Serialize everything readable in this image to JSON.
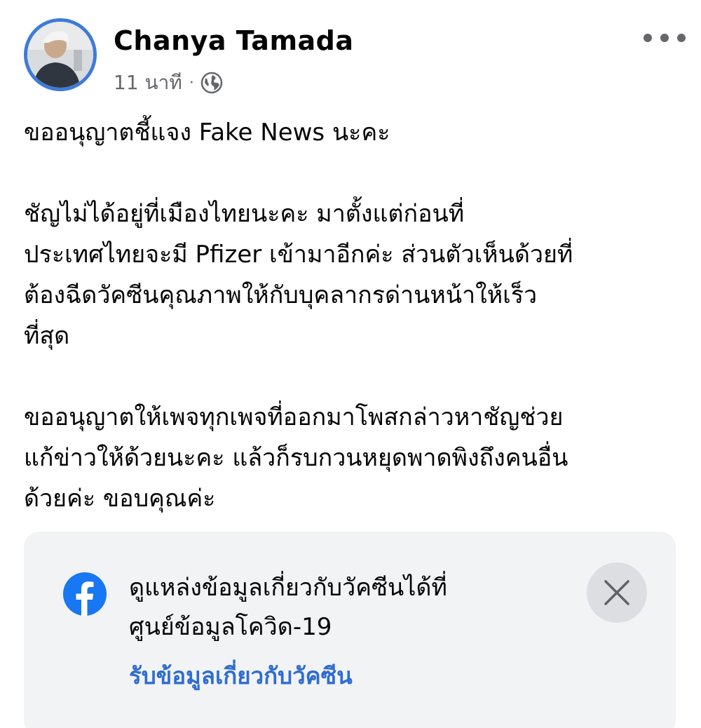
{
  "post": {
    "author": "Chanya Tamada",
    "timestamp": "11 นาที",
    "separator": "·",
    "privacy_icon": "globe-icon",
    "more_icon": "more-options-icon",
    "paragraphs": [
      [
        "ขออนุญาตชี้แจง Fake News นะคะ"
      ],
      [
        "ชัญไม่ได้อยู่ที่เมืองไทยนะคะ มาตั้งแต่ก่อนที่",
        "ประเทศไทยจะมี Pfizer เข้ามาอีกค่ะ ส่วนตัวเห็นด้วยที่",
        "ต้องฉีดวัคซีนคุณภาพให้กับบุคลากรด่านหน้าให้เร็ว",
        "ที่สุด"
      ],
      [
        "ขออนุญาตให้เพจทุกเพจที่ออกมาโพสกล่าวหาชัญช่วย",
        "แก้ข่าวให้ด้วยนะคะ แล้วก็รบกวนหยุดพาดพิงถึงคนอื่น",
        "ด้วยค่ะ ขอบคุณค่ะ"
      ]
    ]
  },
  "info_card": {
    "logo_icon": "facebook-logo-icon",
    "message_lines": [
      "ดูแหล่งข้อมูลเกี่ยวกับวัคซีนได้ที่",
      "ศูนย์ข้อมูลโควิด-19"
    ],
    "link_label": "รับข้อมูลเกี่ยวกับวัคซีน",
    "close_icon": "close-icon"
  },
  "colors": {
    "link": "#2e6cd1",
    "facebook_blue": "#1877f2",
    "card_background": "#f2f3f5",
    "muted_text": "#65676b"
  }
}
